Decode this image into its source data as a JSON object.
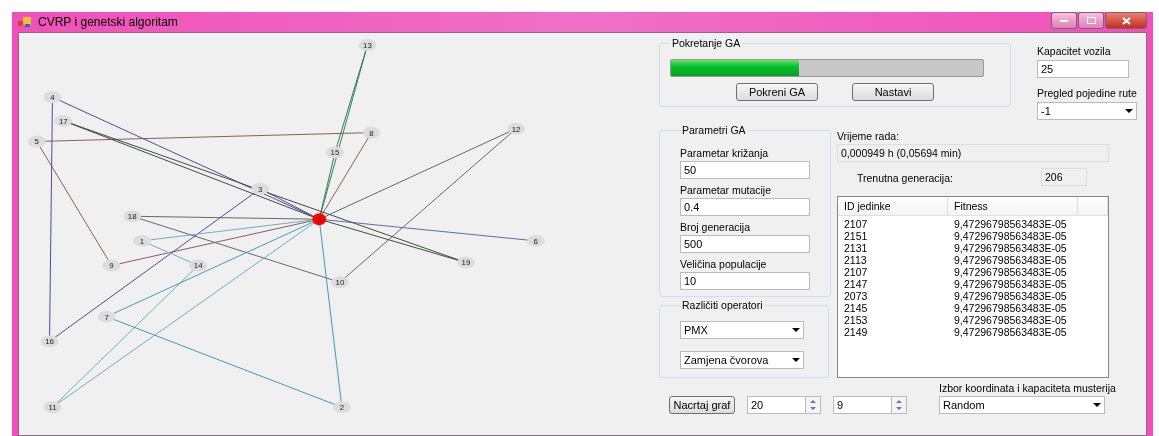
{
  "window": {
    "title": "CVRP i genetski algoritam"
  },
  "graph": {
    "nodes": [
      "0",
      "1",
      "2",
      "3",
      "4",
      "5",
      "6",
      "7",
      "8",
      "9",
      "10",
      "11",
      "12",
      "13",
      "14",
      "15",
      "16",
      "17",
      "18",
      "19"
    ]
  },
  "run_group": {
    "title": "Pokretanje GA",
    "progress": {
      "level": 0.41
    },
    "buttons": [
      "Pokreni GA",
      "Nastavi"
    ]
  },
  "capacity": {
    "label": "Kapacitet vozila",
    "value": "25"
  },
  "route_view": {
    "label": "Pregled pojedine rute",
    "value": "-1"
  },
  "params_group": {
    "title": "Parametri GA",
    "fields": [
      {
        "label": "Parametar križanja",
        "value": "50"
      },
      {
        "label": "Parametar mutacije",
        "value": "0.4"
      },
      {
        "label": "Broj generacija",
        "value": "500"
      },
      {
        "label": "Veličina populacije",
        "value": "10"
      }
    ]
  },
  "operators_group": {
    "title": "Različiti operatori",
    "dropdowns": [
      "PMX",
      "Zamjena čvorova"
    ]
  },
  "runtime": {
    "label": "Vrijeme rada:",
    "value": "0,000949 h (0,05694 min)"
  },
  "generation": {
    "label": "Trenutna generacija:",
    "value": "206"
  },
  "table": {
    "columns": [
      "ID jedinke",
      "Fitness"
    ],
    "rows": [
      [
        "2107",
        "9,47296798563483E-05"
      ],
      [
        "2151",
        "9,47296798563483E-05"
      ],
      [
        "2131",
        "9,47296798563483E-05"
      ],
      [
        "2113",
        "9,47296798563483E-05"
      ],
      [
        "2107",
        "9,47296798563483E-05"
      ],
      [
        "2147",
        "9,47296798563483E-05"
      ],
      [
        "2073",
        "9,47296798563483E-05"
      ],
      [
        "2145",
        "9,47296798563483E-05"
      ],
      [
        "2153",
        "9,47296798563483E-05"
      ],
      [
        "2149",
        "9,47296798563483E-05"
      ]
    ]
  },
  "draw_button": "Nacrtaj graf",
  "spinners": [
    "20",
    "9"
  ],
  "customer_source": {
    "label": "Izbor koordinata i kapaciteta musterija",
    "value": "Random"
  }
}
